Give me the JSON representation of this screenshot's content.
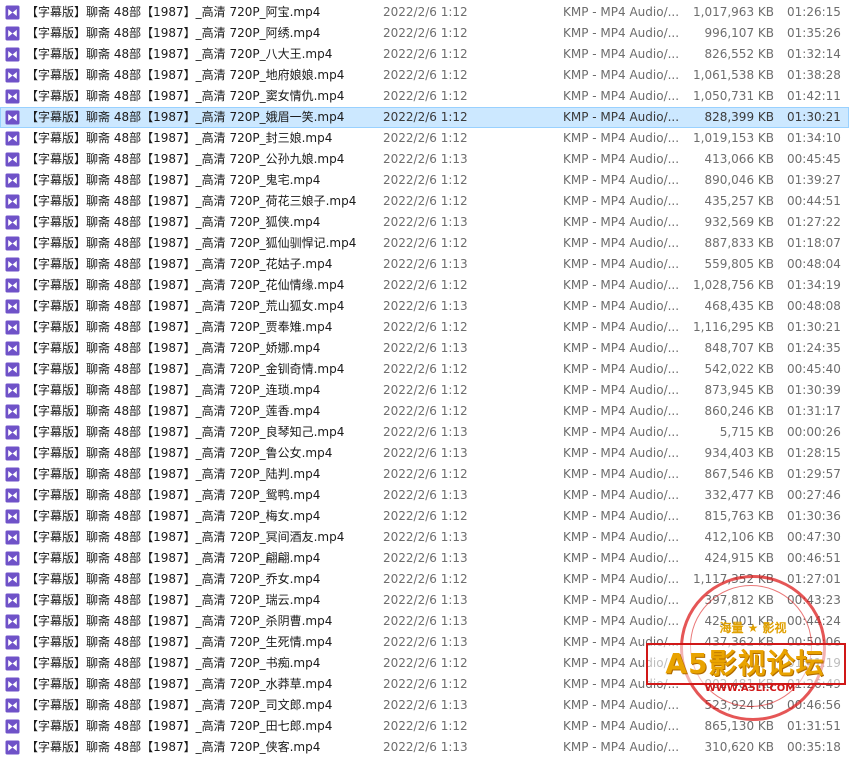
{
  "file_type": "KMP - MP4 Audio/...",
  "files": [
    {
      "name": "【字幕版】聊斋 48部【1987】_高清 720P_阿宝.mp4",
      "date": "2022/2/6 1:12",
      "size": "1,017,963 KB",
      "length": "01:26:15"
    },
    {
      "name": "【字幕版】聊斋 48部【1987】_高清 720P_阿绣.mp4",
      "date": "2022/2/6 1:12",
      "size": "996,107 KB",
      "length": "01:35:26"
    },
    {
      "name": "【字幕版】聊斋 48部【1987】_高清 720P_八大王.mp4",
      "date": "2022/2/6 1:12",
      "size": "826,552 KB",
      "length": "01:32:14"
    },
    {
      "name": "【字幕版】聊斋 48部【1987】_高清 720P_地府娘娘.mp4",
      "date": "2022/2/6 1:12",
      "size": "1,061,538 KB",
      "length": "01:38:28"
    },
    {
      "name": "【字幕版】聊斋 48部【1987】_高清 720P_窦女情仇.mp4",
      "date": "2022/2/6 1:12",
      "size": "1,050,731 KB",
      "length": "01:42:11"
    },
    {
      "name": "【字幕版】聊斋 48部【1987】_高清 720P_娥眉一笑.mp4",
      "date": "2022/2/6 1:12",
      "size": "828,399 KB",
      "length": "01:30:21",
      "selected": true
    },
    {
      "name": "【字幕版】聊斋 48部【1987】_高清 720P_封三娘.mp4",
      "date": "2022/2/6 1:12",
      "size": "1,019,153 KB",
      "length": "01:34:10"
    },
    {
      "name": "【字幕版】聊斋 48部【1987】_高清 720P_公孙九娘.mp4",
      "date": "2022/2/6 1:13",
      "size": "413,066 KB",
      "length": "00:45:45"
    },
    {
      "name": "【字幕版】聊斋 48部【1987】_高清 720P_鬼宅.mp4",
      "date": "2022/2/6 1:12",
      "size": "890,046 KB",
      "length": "01:39:27"
    },
    {
      "name": "【字幕版】聊斋 48部【1987】_高清 720P_荷花三娘子.mp4",
      "date": "2022/2/6 1:12",
      "size": "435,257 KB",
      "length": "00:44:51"
    },
    {
      "name": "【字幕版】聊斋 48部【1987】_高清 720P_狐侠.mp4",
      "date": "2022/2/6 1:13",
      "size": "932,569 KB",
      "length": "01:27:22"
    },
    {
      "name": "【字幕版】聊斋 48部【1987】_高清 720P_狐仙驯悍记.mp4",
      "date": "2022/2/6 1:12",
      "size": "887,833 KB",
      "length": "01:18:07"
    },
    {
      "name": "【字幕版】聊斋 48部【1987】_高清 720P_花姑子.mp4",
      "date": "2022/2/6 1:13",
      "size": "559,805 KB",
      "length": "00:48:04"
    },
    {
      "name": "【字幕版】聊斋 48部【1987】_高清 720P_花仙情缘.mp4",
      "date": "2022/2/6 1:12",
      "size": "1,028,756 KB",
      "length": "01:34:19"
    },
    {
      "name": "【字幕版】聊斋 48部【1987】_高清 720P_荒山狐女.mp4",
      "date": "2022/2/6 1:13",
      "size": "468,435 KB",
      "length": "00:48:08"
    },
    {
      "name": "【字幕版】聊斋 48部【1987】_高清 720P_贾奉雉.mp4",
      "date": "2022/2/6 1:12",
      "size": "1,116,295 KB",
      "length": "01:30:21"
    },
    {
      "name": "【字幕版】聊斋 48部【1987】_高清 720P_娇娜.mp4",
      "date": "2022/2/6 1:13",
      "size": "848,707 KB",
      "length": "01:24:35"
    },
    {
      "name": "【字幕版】聊斋 48部【1987】_高清 720P_金钏奇情.mp4",
      "date": "2022/2/6 1:12",
      "size": "542,022 KB",
      "length": "00:45:40"
    },
    {
      "name": "【字幕版】聊斋 48部【1987】_高清 720P_连琐.mp4",
      "date": "2022/2/6 1:12",
      "size": "873,945 KB",
      "length": "01:30:39"
    },
    {
      "name": "【字幕版】聊斋 48部【1987】_高清 720P_莲香.mp4",
      "date": "2022/2/6 1:12",
      "size": "860,246 KB",
      "length": "01:31:17"
    },
    {
      "name": "【字幕版】聊斋 48部【1987】_高清 720P_良琴知己.mp4",
      "date": "2022/2/6 1:13",
      "size": "5,715 KB",
      "length": "00:00:26"
    },
    {
      "name": "【字幕版】聊斋 48部【1987】_高清 720P_鲁公女.mp4",
      "date": "2022/2/6 1:13",
      "size": "934,403 KB",
      "length": "01:28:15"
    },
    {
      "name": "【字幕版】聊斋 48部【1987】_高清 720P_陆判.mp4",
      "date": "2022/2/6 1:12",
      "size": "867,546 KB",
      "length": "01:29:57"
    },
    {
      "name": "【字幕版】聊斋 48部【1987】_高清 720P_鸳鸭.mp4",
      "date": "2022/2/6 1:13",
      "size": "332,477 KB",
      "length": "00:27:46"
    },
    {
      "name": "【字幕版】聊斋 48部【1987】_高清 720P_梅女.mp4",
      "date": "2022/2/6 1:12",
      "size": "815,763 KB",
      "length": "01:30:36"
    },
    {
      "name": "【字幕版】聊斋 48部【1987】_高清 720P_冥间酒友.mp4",
      "date": "2022/2/6 1:13",
      "size": "412,106 KB",
      "length": "00:47:30"
    },
    {
      "name": "【字幕版】聊斋 48部【1987】_高清 720P_翩翩.mp4",
      "date": "2022/2/6 1:13",
      "size": "424,915 KB",
      "length": "00:46:51"
    },
    {
      "name": "【字幕版】聊斋 48部【1987】_高清 720P_乔女.mp4",
      "date": "2022/2/6 1:12",
      "size": "1,117,352 KB",
      "length": "01:27:01"
    },
    {
      "name": "【字幕版】聊斋 48部【1987】_高清 720P_瑞云.mp4",
      "date": "2022/2/6 1:13",
      "size": "397,812 KB",
      "length": "00:43:23"
    },
    {
      "name": "【字幕版】聊斋 48部【1987】_高清 720P_杀阴曹.mp4",
      "date": "2022/2/6 1:13",
      "size": "425,001 KB",
      "length": "00:44:24"
    },
    {
      "name": "【字幕版】聊斋 48部【1987】_高清 720P_生死情.mp4",
      "date": "2022/2/6 1:13",
      "size": "437,362 KB",
      "length": "00:50:06"
    },
    {
      "name": "【字幕版】聊斋 48部【1987】_高清 720P_书痴.mp4",
      "date": "2022/2/6 1:12",
      "size": "",
      "length": "01:41:19"
    },
    {
      "name": "【字幕版】聊斋 48部【1987】_高清 720P_水莽草.mp4",
      "date": "2022/2/6 1:12",
      "size": "902,481 KB",
      "length": "01:26:49"
    },
    {
      "name": "【字幕版】聊斋 48部【1987】_高清 720P_司文郎.mp4",
      "date": "2022/2/6 1:13",
      "size": "523,924 KB",
      "length": "00:46:56"
    },
    {
      "name": "【字幕版】聊斋 48部【1987】_高清 720P_田七郎.mp4",
      "date": "2022/2/6 1:12",
      "size": "865,130 KB",
      "length": "01:31:51"
    },
    {
      "name": "【字幕版】聊斋 48部【1987】_高清 720P_侠客.mp4",
      "date": "2022/2/6 1:13",
      "size": "310,620 KB",
      "length": "00:35:18"
    }
  ],
  "watermark": {
    "top_text": "海量 ★ 影视",
    "title": "A5影视论坛",
    "url": "WWW.A5LT.COM"
  },
  "colors": {
    "selection": "#cce8ff",
    "selection_border": "#99d1ff",
    "icon": "#6f52c8",
    "stamp_red": "#d01818",
    "stamp_gold": "#e9a300"
  }
}
